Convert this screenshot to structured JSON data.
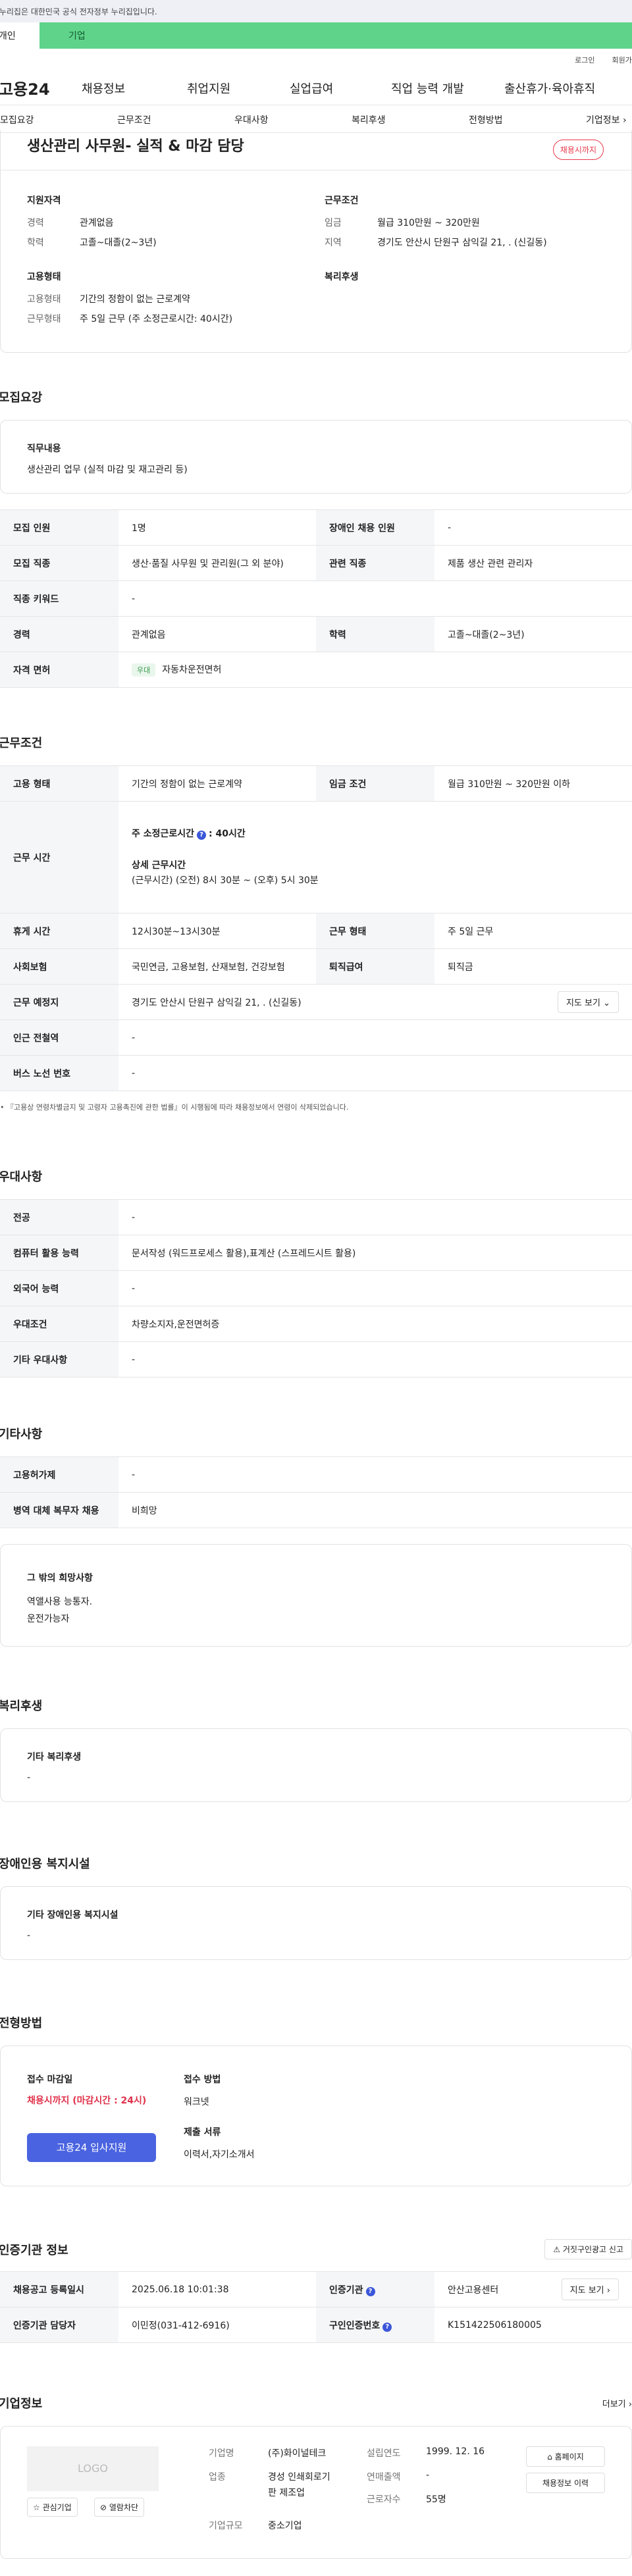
{
  "topbar": {
    "notice": "이 누리집은 대한민국 공식 전자정부 누리집입니다."
  },
  "site_tabs": {
    "individual": "개인",
    "corporate": "기업"
  },
  "util": {
    "login": "로그인",
    "join": "회원가입"
  },
  "gnb": {
    "logo": "고용24",
    "menu": [
      "채용정보",
      "취업지원",
      "실업급여",
      "직업 능력 개발",
      "출산휴가·육아휴직"
    ]
  },
  "subnav": [
    "모집요강",
    "근무조건",
    "우대사항",
    "복리후생",
    "전형방법",
    "기업정보"
  ],
  "job": {
    "title": "생산관리 사무원- 실적 & 마감 담당",
    "status": "채용시까지",
    "qual_head": "지원자격",
    "cond_head": "근무조건",
    "employ_head": "고용형태",
    "welfare_head": "복리후생",
    "qual": [
      {
        "k": "경력",
        "v": "관계없음"
      },
      {
        "k": "학력",
        "v": "고졸~대졸(2~3년)"
      }
    ],
    "cond": [
      {
        "k": "임금",
        "v": "월급 310만원 ~ 320만원"
      },
      {
        "k": "지역",
        "v": "경기도 안산시 단원구 삼익길 21, . (신길동)"
      }
    ],
    "employ": [
      {
        "k": "고용형태",
        "v": "기간의 정함이 없는 근로계약"
      },
      {
        "k": "근무형태",
        "v": "주 5일 근무 (주 소정근로시간: 40시간)"
      }
    ]
  },
  "recruit": {
    "title": "모집요강",
    "duty_head": "직무내용",
    "duty_body": "생산관리 업무 (실적 마감 및 재고관리 등)",
    "rows": [
      {
        "k1": "모집 인원",
        "v1": "1명",
        "k2": "장애인 채용 인원",
        "v2": "-"
      },
      {
        "k1": "모집 직종",
        "v1": "생산·품질 사무원 및 관리원(그 외 분야)",
        "k2": "관련 직종",
        "v2": "제품 생산 관련 관리자"
      },
      {
        "k1": "직종 키워드",
        "v1": "-"
      },
      {
        "k1": "경력",
        "v1": "관계없음",
        "k2": "학력",
        "v2": "고졸~대졸(2~3년)"
      },
      {
        "k1": "자격 면허",
        "v1": "자동차운전면허",
        "pill": "우대"
      }
    ]
  },
  "work": {
    "title": "근무조건",
    "employ_k": "고용 형태",
    "employ_v": "기간의 정함이 없는 근로계약",
    "wage_k": "임금 조건",
    "wage_v": "월급 310만원 ~ 320만원 이하",
    "hours_k": "근무 시간",
    "hours_weekly_label": "주 소정근로시간",
    "hours_weekly_value": ": 40시간",
    "hours_detail_label": "상세 근무시간",
    "hours_detail_value": "(근무시간) (오전) 8시 30분 ~ (오후) 5시 30분",
    "break_k": "휴게 시간",
    "break_v": "12시30분~13시30분",
    "form_k": "근무 형태",
    "form_v": "주 5일 근무",
    "ins_k": "사회보험",
    "ins_v": "국민연금, 고용보험, 산재보험, 건강보험",
    "retire_k": "퇴직급여",
    "retire_v": "퇴직금",
    "place_k": "근무 예정지",
    "place_v": "경기도 안산시 단원구 삼익길 21, . (신길동)",
    "map_btn": "지도 보기",
    "subway_k": "인근 전철역",
    "subway_v": "-",
    "bus_k": "버스 노선 번호",
    "bus_v": "-",
    "footnote": "『고용상 연령차별금지 및 고령자 고용촉진에 관한 법률』이 시행됨에 따라 채용정보에서 연령이 삭제되었습니다."
  },
  "pref": {
    "title": "우대사항",
    "rows": [
      {
        "k": "전공",
        "v": "-"
      },
      {
        "k": "컴퓨터 활용 능력",
        "v": "문서작성 (워드프로세스 활용),표계산 (스프레드시트 활용)"
      },
      {
        "k": "외국어 능력",
        "v": "-"
      },
      {
        "k": "우대조건",
        "v": "차량소지자,운전면허증"
      },
      {
        "k": "기타 우대사항",
        "v": "-"
      }
    ]
  },
  "etc": {
    "title": "기타사항",
    "rows": [
      {
        "k": "고용허가제",
        "v": "-"
      },
      {
        "k": "병역 대체 복무자 채용",
        "v": "비희망"
      }
    ],
    "wish_head": "그 밖의 희망사항",
    "wish_lines": [
      "역앨사용 능통자.",
      "운전가능자"
    ]
  },
  "welfare": {
    "title": "복리후생",
    "head": "기타 복리후생",
    "body": "-"
  },
  "disab": {
    "title": "장애인용 복지시설",
    "head": "기타 장애인용 복지시설",
    "body": "-"
  },
  "screen": {
    "title": "전형방법",
    "deadline_head": "접수 마감일",
    "deadline_value": "채용시까지 (마감시간 : 24시)",
    "apply_btn": "고용24 입사지원",
    "method_head": "접수 방법",
    "method_value": "워크넷",
    "docs_head": "제출 서류",
    "docs_value": "이력서,자기소개서"
  },
  "agency": {
    "title": "인증기관 정보",
    "report_btn": "거짓구인광고 신고",
    "reg_k": "채용공고 등록일시",
    "reg_v": "2025.06.18 10:01:38",
    "org_k": "인증기관",
    "org_v": "안산고용센터",
    "map_btn": "지도 보기",
    "mgr_k": "인증기관 담당자",
    "mgr_v": "이민정(031-412-6916)",
    "code_k": "구인인증번호",
    "code_v": "K151422506180005"
  },
  "company": {
    "title": "기업정보",
    "more": "더보기",
    "logo": "LOGO",
    "fav_btn": "관심기업",
    "block_btn": "열람차단",
    "name_k": "기업명",
    "name_v": "(주)화이널테크",
    "founded_k": "설립연도",
    "founded_v": "1999. 12. 16",
    "ind_k": "업종",
    "ind_v1": "경성 인쇄회로기",
    "ind_v2": "판 제조업",
    "sales_k": "연매출액",
    "sales_v": "-",
    "scale_k": "기업규모",
    "scale_v": "중소기업",
    "emp_k": "근로자수",
    "emp_v": "55명",
    "home_btn": "홈페이지",
    "jobs_btn": "채용정보 이력"
  }
}
